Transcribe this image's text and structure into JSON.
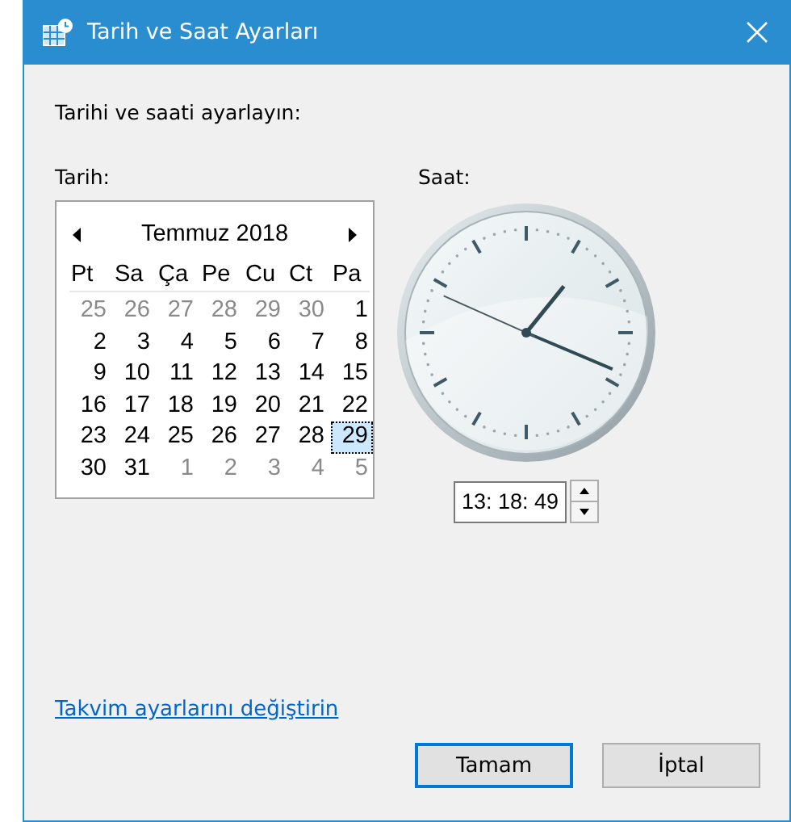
{
  "window": {
    "title": "Tarih ve Saat Ayarları"
  },
  "instruction": "Tarihi ve saati ayarlayın:",
  "date_label": "Tarih:",
  "time_label": "Saat:",
  "calendar": {
    "month": "Temmuz 2018",
    "weekdays": [
      "Pt",
      "Sa",
      "Ça",
      "Pe",
      "Cu",
      "Ct",
      "Pa"
    ],
    "days": [
      {
        "label": "25",
        "muted": true,
        "selected": false
      },
      {
        "label": "26",
        "muted": true,
        "selected": false
      },
      {
        "label": "27",
        "muted": true,
        "selected": false
      },
      {
        "label": "28",
        "muted": true,
        "selected": false
      },
      {
        "label": "29",
        "muted": true,
        "selected": false
      },
      {
        "label": "30",
        "muted": true,
        "selected": false
      },
      {
        "label": "1",
        "muted": false,
        "selected": false
      },
      {
        "label": "2",
        "muted": false,
        "selected": false
      },
      {
        "label": "3",
        "muted": false,
        "selected": false
      },
      {
        "label": "4",
        "muted": false,
        "selected": false
      },
      {
        "label": "5",
        "muted": false,
        "selected": false
      },
      {
        "label": "6",
        "muted": false,
        "selected": false
      },
      {
        "label": "7",
        "muted": false,
        "selected": false
      },
      {
        "label": "8",
        "muted": false,
        "selected": false
      },
      {
        "label": "9",
        "muted": false,
        "selected": false
      },
      {
        "label": "10",
        "muted": false,
        "selected": false
      },
      {
        "label": "11",
        "muted": false,
        "selected": false
      },
      {
        "label": "12",
        "muted": false,
        "selected": false
      },
      {
        "label": "13",
        "muted": false,
        "selected": false
      },
      {
        "label": "14",
        "muted": false,
        "selected": false
      },
      {
        "label": "15",
        "muted": false,
        "selected": false
      },
      {
        "label": "16",
        "muted": false,
        "selected": false
      },
      {
        "label": "17",
        "muted": false,
        "selected": false
      },
      {
        "label": "18",
        "muted": false,
        "selected": false
      },
      {
        "label": "19",
        "muted": false,
        "selected": false
      },
      {
        "label": "20",
        "muted": false,
        "selected": false
      },
      {
        "label": "21",
        "muted": false,
        "selected": false
      },
      {
        "label": "22",
        "muted": false,
        "selected": false
      },
      {
        "label": "23",
        "muted": false,
        "selected": false
      },
      {
        "label": "24",
        "muted": false,
        "selected": false
      },
      {
        "label": "25",
        "muted": false,
        "selected": false
      },
      {
        "label": "26",
        "muted": false,
        "selected": false
      },
      {
        "label": "27",
        "muted": false,
        "selected": false
      },
      {
        "label": "28",
        "muted": false,
        "selected": false
      },
      {
        "label": "29",
        "muted": false,
        "selected": true
      },
      {
        "label": "30",
        "muted": false,
        "selected": false
      },
      {
        "label": "31",
        "muted": false,
        "selected": false
      },
      {
        "label": "1",
        "muted": true,
        "selected": false
      },
      {
        "label": "2",
        "muted": true,
        "selected": false
      },
      {
        "label": "3",
        "muted": true,
        "selected": false
      },
      {
        "label": "4",
        "muted": true,
        "selected": false
      },
      {
        "label": "5",
        "muted": true,
        "selected": false
      }
    ]
  },
  "time_field": {
    "value": "13: 18: 49"
  },
  "link": "Takvim ayarlarını değiştirin",
  "buttons": [
    {
      "label": "Tamam",
      "default": true
    },
    {
      "label": "İptal",
      "default": false
    }
  ]
}
